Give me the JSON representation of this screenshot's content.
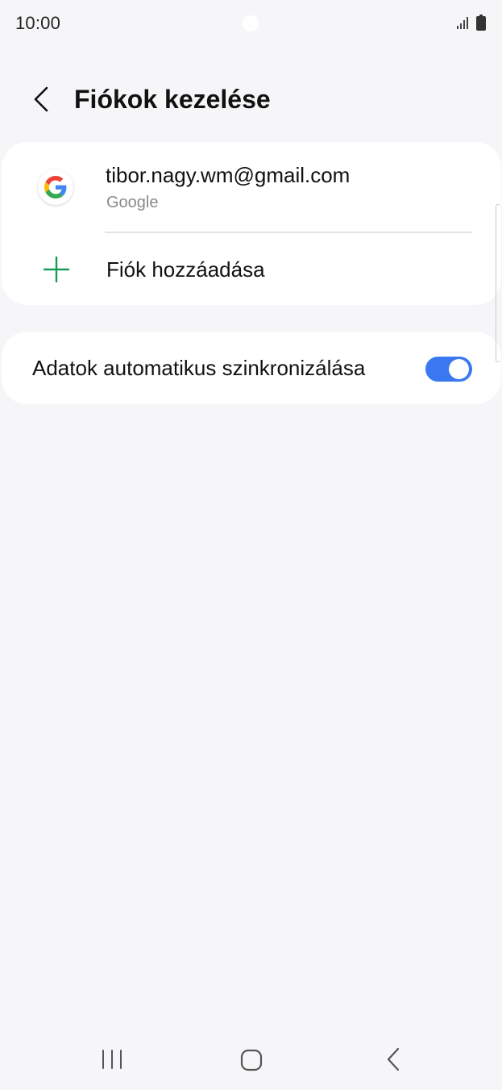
{
  "status_bar": {
    "time": "10:00"
  },
  "header": {
    "title": "Fiókok kezelése",
    "back_icon": "chevron-left-icon"
  },
  "accounts": {
    "items": [
      {
        "email": "tibor.nagy.wm@gmail.com",
        "provider": "Google",
        "icon": "google-icon"
      }
    ],
    "add_account_label": "Fiók hozzáadása",
    "add_icon": "plus-icon"
  },
  "sync": {
    "label": "Adatok automatikus szinkronizálása",
    "enabled": true
  },
  "colors": {
    "background": "#f6f6f8",
    "card": "#ffffff",
    "accent_toggle": "#3a78f2",
    "plus_green": "#1a9a5a",
    "secondary_text": "#8a8a8a"
  },
  "nav_bar": {
    "recents_icon": "recents-icon",
    "home_icon": "home-icon",
    "back_icon": "back-icon"
  }
}
